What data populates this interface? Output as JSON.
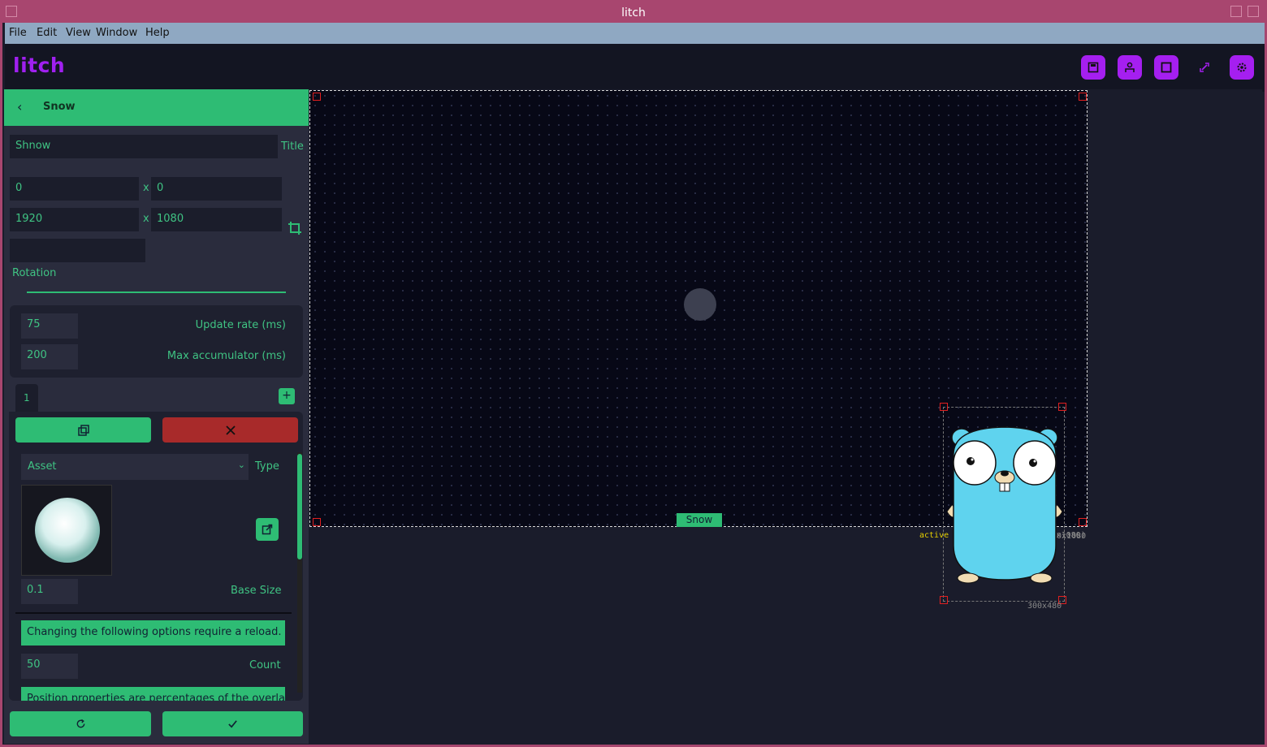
{
  "window": {
    "title": "litch"
  },
  "menu": [
    "File",
    "Edit",
    "View",
    "Window",
    "Help"
  ],
  "app": {
    "logo": "litch"
  },
  "toolbar_icons": [
    "save-icon",
    "upload-icon",
    "square-icon",
    "link-icon",
    "gear-icon"
  ],
  "panel": {
    "header": "Snow",
    "title_value": "Shnow",
    "title_label": "Title",
    "pos_x": "0",
    "pos_y": "0",
    "size_w": "1920",
    "size_h": "1080",
    "times": "x",
    "rotation_value": "",
    "rotation_label": "Rotation",
    "update_rate_value": "75",
    "update_rate_label": "Update rate (ms)",
    "max_acc_value": "200",
    "max_acc_label": "Max accumulator (ms)",
    "tab_label": "1",
    "add_label": "+",
    "type_value": "Asset",
    "type_label": "Type",
    "base_size_value": "0.1",
    "base_size_label": "Base Size",
    "reload_notice": "Changing the following options require a reload.",
    "count_value": "50",
    "count_label": "Count",
    "position_notice": "Position properties are percentages of the overlay"
  },
  "canvas": {
    "snow_tag": "Snow",
    "overlay_active": "active",
    "overlay_info": "1920x1080 @ 50% (1920x1080)",
    "stage_size": "20x1080",
    "gopher_size": "300x480"
  },
  "colors": {
    "accent": "#2ebc74",
    "brand": "#a020f0",
    "danger": "#a82a2a",
    "frame": "#a8466f"
  }
}
